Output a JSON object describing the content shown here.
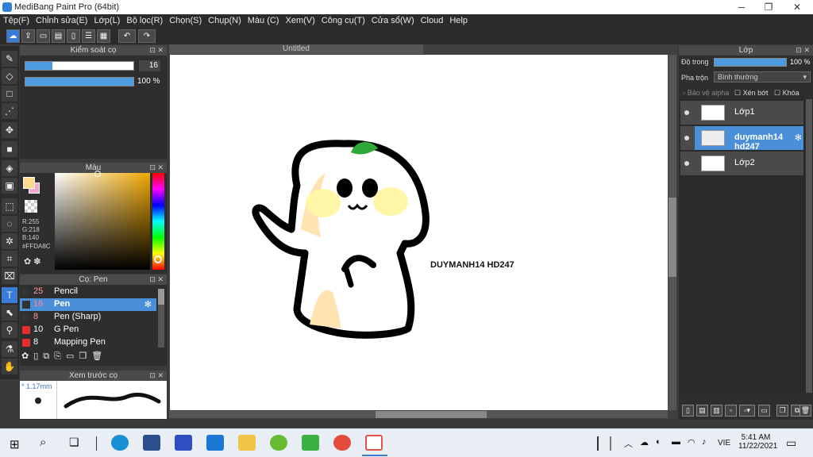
{
  "window": {
    "title": "MediBang Paint Pro (64bit)"
  },
  "menu": [
    "Tệp(F)",
    "Chỉnh sửa(E)",
    "Lớp(L)",
    "Bộ lọc(R)",
    "Chọn(S)",
    "Chụp(N)",
    "Màu (C)",
    "Xem(V)",
    "Công cụ(T)",
    "Cửa sổ(W)",
    "Cloud",
    "Help"
  ],
  "brush_control": {
    "title": "Kiểm soát cọ",
    "size": "16",
    "opacity": "100 %",
    "size_fill": 0.25,
    "opacity_fill": 1.0
  },
  "color": {
    "title": "Màu",
    "r": "R:255",
    "g": "G:218",
    "b": "B:140",
    "hex": "#FFDA8C",
    "main_color": "#FFDA8C",
    "secondary_color": "#F4A7D0"
  },
  "brushes": {
    "title": "Cọ: Pen",
    "items": [
      {
        "size": "25",
        "name": "Pencil",
        "color": "#333333",
        "selected": false
      },
      {
        "size": "16",
        "name": "Pen",
        "color": "#333333",
        "selected": true
      },
      {
        "size": "8",
        "name": "Pen (Sharp)",
        "color": "#333333",
        "selected": false
      },
      {
        "size": "10",
        "name": "G Pen",
        "color": "#e03030",
        "selected": false
      },
      {
        "size": "8",
        "name": "Mapping Pen",
        "color": "#e03030",
        "selected": false
      }
    ]
  },
  "preview": {
    "title": "Xem trước cọ",
    "size": "* 1.17mm"
  },
  "canvas": {
    "tab": "Untitled",
    "signature": "DUYMANH14 HD247"
  },
  "layers": {
    "title": "Lớp",
    "opacity_label": "Độ trong",
    "opacity_value": "100 %",
    "blend_label": "Pha trộn",
    "blend_value": "Bình thường",
    "alpha_protect": "Bảo vệ alpha",
    "clipping": "Xén bớt",
    "lock": "Khóa",
    "items": [
      {
        "name": "Lớp1",
        "selected": false
      },
      {
        "name": "duymanh14 hd247",
        "selected": true
      },
      {
        "name": "Lớp2",
        "selected": false
      }
    ]
  },
  "taskbar": {
    "time": "5:41 AM",
    "date": "11/22/2021",
    "lang": "VIE"
  }
}
